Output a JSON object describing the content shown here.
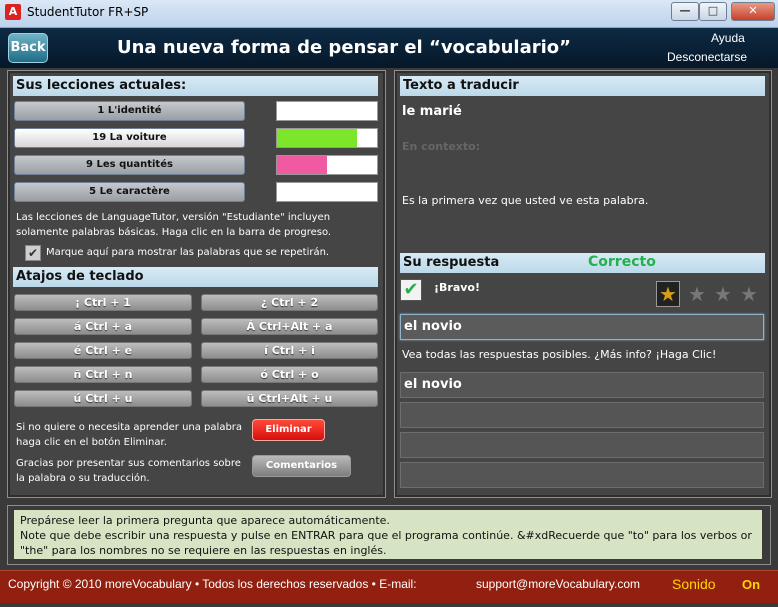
{
  "window": {
    "title": "StudentTutor FR+SP",
    "app_icon": "A"
  },
  "header": {
    "back_label": "Back",
    "title": "Una nueva forma de pensar el “vocabulario”",
    "help": "Ayuda",
    "logout": "Desconectarse"
  },
  "lessons": {
    "heading": "Sus lecciones actuales:",
    "items": [
      {
        "label": "1 L'identité",
        "progress": 0,
        "color": "#ffffff",
        "active": false
      },
      {
        "label": "19 La voiture",
        "progress": 0.8,
        "color": "#7ee62a",
        "active": true
      },
      {
        "label": "9 Les quantités",
        "progress": 0.5,
        "color": "#f05aa0",
        "active": false
      },
      {
        "label": "5 Le caractère",
        "progress": 0,
        "color": "#ffffff",
        "active": false
      }
    ],
    "info": "Las lecciones de LanguageTutor, versión \"Estudiante\" incluyen solamente palabras básicas. Haga clic en la barra de progreso.",
    "repeat_checkbox_label": "Marque aquí para mostrar las palabras que se repetirán.",
    "repeat_checked": true
  },
  "shortcuts": {
    "heading": "Atajos de teclado",
    "left": [
      "¡  Ctrl + 1",
      "á  Ctrl + a",
      "é  Ctrl + e",
      "ñ  Ctrl + n",
      "ú  Ctrl + u"
    ],
    "right": [
      "¿  Ctrl + 2",
      "Á  Ctrl+Alt + a",
      "í  Ctrl + i",
      "ó  Ctrl + o",
      "ü  Ctrl+Alt + u"
    ]
  },
  "actions": {
    "delete_text": "Si no quiere o necesita aprender una palabra haga clic en el botón Eliminar.",
    "delete_label": "Eliminar",
    "comment_text": "Gracias por presentar sus comentarios sobre la palabra o su traducción.",
    "comment_label": "Comentarios"
  },
  "translate": {
    "heading": "Texto a traducir",
    "word": "le marié",
    "context_label": "En contexto:",
    "first_time": "Es la primera vez que usted ve esta palabra."
  },
  "answer": {
    "heading": "Su respuesta",
    "status": "Correcto",
    "bravo": "¡Bravo!",
    "stars_filled": 1,
    "stars_total": 4,
    "input_value": "el novio",
    "see_all": "Vea todas las respuestas posibles. ¿Más info? ¡Haga Clic!",
    "possible": [
      "el novio",
      "",
      "",
      ""
    ]
  },
  "instructions": {
    "lines": [
      "Prepárese leer la primera pregunta que aparece automáticamente.",
      "Note que debe escribir una respuesta y pulse en ENTRAR para que el programa continúe. &#xdRecuerde que \"to\" para los verbos or \"the\" para los nombres no se requiere en las respuestas en inglés."
    ]
  },
  "footer": {
    "copyright": "Copyright © 2010 moreVocabulary • Todos los derechos reservados • E-mail:",
    "email": "support@moreVocabulary.com",
    "sound_label": "Sonido",
    "sound_state": "On"
  },
  "colors": {
    "accent_green": "#22b14c",
    "delete_red": "#e41a1a",
    "footer_bg": "#922010",
    "sound_yellow": "#ffd700"
  }
}
